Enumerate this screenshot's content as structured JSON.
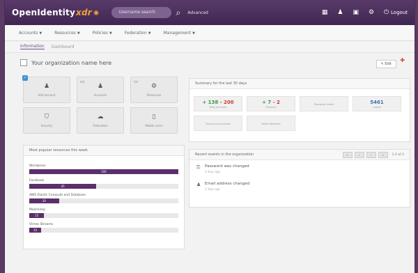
{
  "header": {
    "logo_text": "OpenIdentity",
    "logo_suffix": "xdr",
    "search_placeholder": "Username search",
    "advanced_label": "Advanced",
    "logout_label": "Logout",
    "icons": [
      "grid-icon",
      "user-icon",
      "chat-icon",
      "gear-icon",
      "logout-icon"
    ]
  },
  "menu": {
    "items": [
      "Accounts",
      "Resources",
      "Policies",
      "Federation",
      "Management"
    ]
  },
  "tabs": {
    "active": "Information",
    "other": "Dashboard"
  },
  "org": {
    "name": "Your organization name here",
    "edit_label": "Edit"
  },
  "quick_actions": [
    {
      "label": "Add account",
      "icon": "user-icon"
    },
    {
      "label": "Accounts",
      "icon": "users-icon"
    },
    {
      "label": "Resources",
      "icon": "settings-icon"
    },
    {
      "label": "Security",
      "icon": "shield-icon"
    },
    {
      "label": "Federation",
      "icon": "cloud-icon"
    },
    {
      "label": "Mobile users",
      "icon": "tablet-icon"
    }
  ],
  "visited": {
    "title": "Most popular resources this week",
    "items": [
      {
        "label": "Wordpress",
        "value": "100",
        "fill": 1.0
      },
      {
        "label": "Facebook",
        "value": "45",
        "fill": 0.45
      },
      {
        "label": "AWS Elastic Compute and Database",
        "value": "20",
        "fill": 0.2
      },
      {
        "label": "Mailchimp",
        "value": "15",
        "fill": 0.1
      },
      {
        "label": "Vimeo Streams",
        "value": "10",
        "fill": 0.08
      }
    ]
  },
  "activity": {
    "title": "Summary for the last 30 days",
    "metrics": [
      {
        "plus": "+ 138",
        "minus": "- 200",
        "label": "New accounts"
      },
      {
        "plus": "+ 7",
        "minus": "- 2",
        "label": "Sessions"
      },
      {
        "plus": "",
        "minus": "",
        "label": "Password resets"
      },
      {
        "blue": "5461",
        "label": "Logins"
      },
      {
        "plus": "",
        "minus": "",
        "label": "Resources accessed"
      },
      {
        "plus": "",
        "minus": "",
        "label": "Failed attempts"
      }
    ]
  },
  "recent": {
    "title": "Recent events in the organization",
    "pager": [
      "«",
      "‹",
      "›",
      "»"
    ],
    "count": "1-2 of 2",
    "events": [
      {
        "title": "Password was changed",
        "time": "3 days ago",
        "icon": "key-icon"
      },
      {
        "title": "Email address changed",
        "time": "3 days ago",
        "icon": "user-icon"
      }
    ]
  },
  "colors": {
    "accent": "#5a2f6b",
    "topbar": "#4a2d5a",
    "logo_accent": "#f0a23b"
  }
}
